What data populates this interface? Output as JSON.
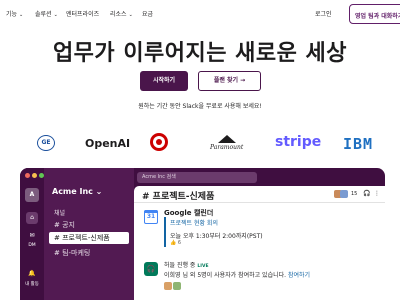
{
  "nav": {
    "items": [
      {
        "label": "기능",
        "chevron": "⌄"
      },
      {
        "label": "솔루션",
        "chevron": "⌄"
      },
      {
        "label": "엔터프라이즈",
        "chevron": ""
      },
      {
        "label": "리소스",
        "chevron": "⌄"
      },
      {
        "label": "요금",
        "chevron": ""
      }
    ],
    "login": "로그인",
    "sales": "영업 팀과 대화하기"
  },
  "hero": {
    "title": "업무가 이루어지는 새로운 세상",
    "primary_cta": "시작하기",
    "secondary_cta": "플랜 찾기 →",
    "note": "원하는 기간 동안 Slack을 무료로 사용해 보세요!"
  },
  "logos": {
    "ge": "GE",
    "openai": "OpenAI",
    "paramount": "Paramount",
    "stripe": "stripe",
    "ibm": "IBM"
  },
  "app": {
    "workspace_badge": "A",
    "workspace_name": "Acme Inc ⌄",
    "search_placeholder": "Acme Inc 검색",
    "rail": {
      "home_icon": "⌂",
      "dm_icon": "✉",
      "dm_label": "DM",
      "activity_icon": "🔔",
      "activity_label": "내 활동"
    },
    "sidebar": {
      "section": "채널",
      "channels": [
        "# 공지",
        "# 프로젝트-신제품",
        "# 팀-마케팅"
      ]
    },
    "channel": {
      "title": "# 프로젝트-신제품",
      "member_count": "15",
      "header_icons": [
        "🎧",
        "⋮"
      ]
    },
    "message1": {
      "sender": "Google 캘린더",
      "icon_text": "31",
      "event": "프로젝트 현황 회의",
      "time": "오늘 오후 1:30부터 2:00까지(PST)",
      "reaction": "👍 6"
    },
    "message2": {
      "icon": "🎧",
      "title": "허들 진행 중",
      "live": "LIVE",
      "desc_prefix": "이희영 님 외 5명이 사용자가 참여하고 있습니다.",
      "join": "참여하기"
    }
  },
  "colors": {
    "aubergine": "#4a154b",
    "sidebar": "#521a52",
    "frame": "#3f0e40",
    "link": "#1264a3",
    "green": "#007a5a"
  }
}
